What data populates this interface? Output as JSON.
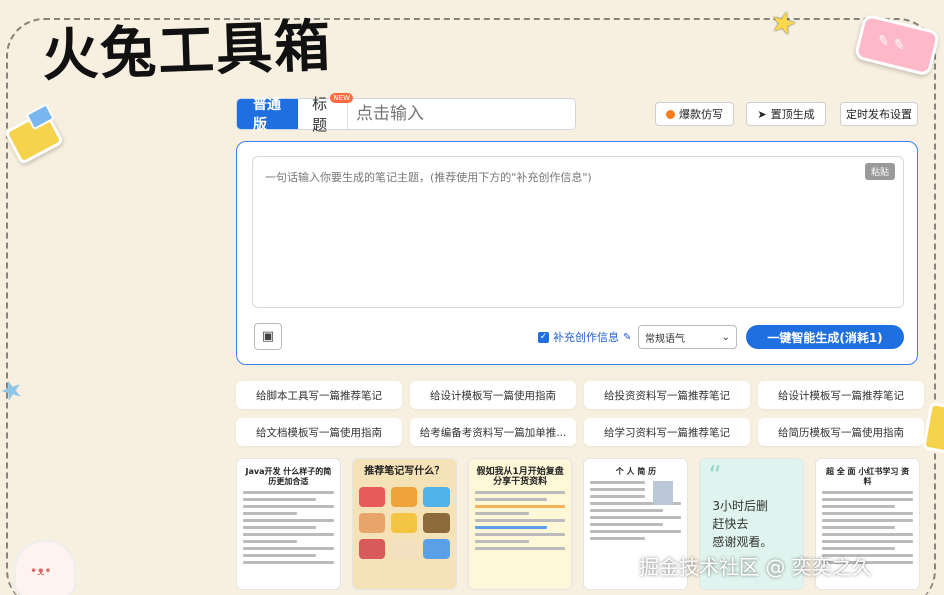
{
  "logo": "火兔工具箱",
  "tabs": {
    "normal": "普通版",
    "title": "标题",
    "title_badge": "NEW",
    "title_input_placeholder": "点击输入"
  },
  "top_buttons": {
    "hot_copy": "爆款仿写",
    "pin_generate": "置顶生成",
    "schedule": "定时发布设置"
  },
  "editor": {
    "placeholder": "一句话输入你要生成的笔记主题，(推荐使用下方的\"补充创作信息\")",
    "paste": "粘贴",
    "supplement_label": "补充创作信息",
    "tone_value": "常规语气",
    "generate_button": "一键智能生成(消耗1)"
  },
  "chips": [
    "给脚本工具写一篇推荐笔记",
    "给设计模板写一篇使用指南",
    "给投资资料写一篇推荐笔记",
    "给设计模板写一篇推荐笔记",
    "给文档模板写一篇使用指南",
    "给考编备考资料写一篇加单推...",
    "给学习资料写一篇推荐笔记",
    "给简历模板写一篇使用指南"
  ],
  "thumbnails": {
    "t1_title": "Java开发 什么样子的简历更加合适",
    "t2_title": "推荐笔记写什么？",
    "t3_title": "假如我从1月开始复盘 分享干货资料",
    "t4_title": "个 人 简 历",
    "t5_text": [
      "3小时后删",
      "赶快去",
      "感谢观看。"
    ],
    "t6_title": "超 全 面 小红书学习 资料"
  },
  "watermark": "掘金技术社区 @ 奕奕之久"
}
